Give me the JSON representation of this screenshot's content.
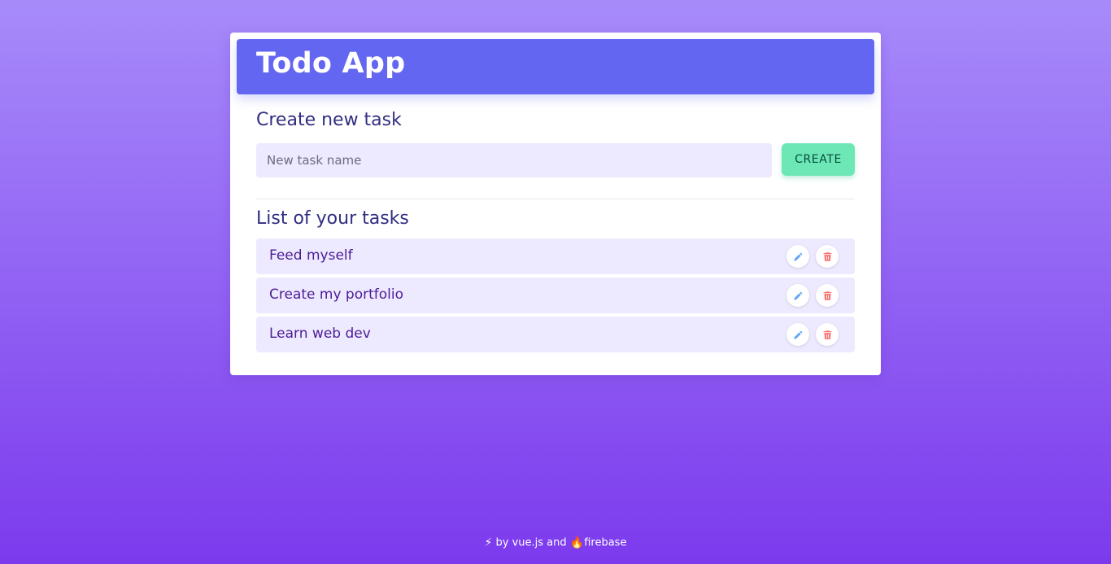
{
  "app": {
    "title": "Todo App"
  },
  "create": {
    "heading": "Create new task",
    "input_placeholder": "New task name",
    "input_value": "",
    "button_label": "CREATE"
  },
  "list": {
    "heading": "List of your tasks",
    "tasks": [
      {
        "label": "Feed myself"
      },
      {
        "label": "Create my portfolio"
      },
      {
        "label": "Learn web dev"
      }
    ],
    "actions": {
      "edit_icon": "pencil-icon",
      "delete_icon": "trash-icon"
    }
  },
  "footer": {
    "bolt_glyph": "⚡",
    "text_by": " by vue.js and ",
    "fire_glyph": "🔥",
    "text_firebase": "firebase"
  },
  "colors": {
    "header_bg": "#6366f1",
    "create_button_bg": "#6ee7b7",
    "task_bg": "#ede9fe",
    "edit_icon": "#60a5fa",
    "delete_icon": "#f87171"
  }
}
